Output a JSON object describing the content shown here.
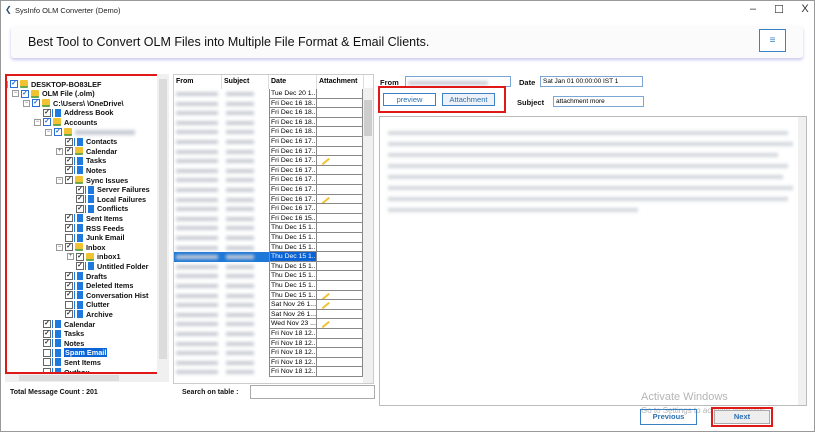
{
  "window": {
    "title": "SysInfo OLM Converter (Demo)",
    "minimize": "–",
    "maximize": "☐",
    "close": "X"
  },
  "banner": {
    "headline": "Best Tool to Convert OLM Files into Multiple File Format & Email Clients.",
    "menu_icon": "≡"
  },
  "tree": [
    {
      "label": "DESKTOP-BO83LEF",
      "depth": 0,
      "checked": true,
      "icon": "folder",
      "exp": "-"
    },
    {
      "label": "OLM File (.olm)",
      "depth": 1,
      "checked": true,
      "icon": "folder",
      "exp": "-"
    },
    {
      "label": "C:\\Users\\        \\OneDrive\\",
      "depth": 2,
      "checked": true,
      "icon": "folder",
      "exp": "-"
    },
    {
      "label": "Address Book",
      "depth": 3,
      "checked": true,
      "icon": "file"
    },
    {
      "label": "Accounts",
      "depth": 3,
      "checked": true,
      "icon": "folder",
      "exp": "-"
    },
    {
      "label": "",
      "depth": 4,
      "checked": true,
      "icon": "folder",
      "exp": "-",
      "blur": true
    },
    {
      "label": "Contacts",
      "depth": 5,
      "checked": true,
      "icon": "file"
    },
    {
      "label": "Calendar",
      "depth": 5,
      "checked": true,
      "icon": "folder",
      "exp": "+"
    },
    {
      "label": "Tasks",
      "depth": 5,
      "checked": true,
      "icon": "file"
    },
    {
      "label": "Notes",
      "depth": 5,
      "checked": true,
      "icon": "file"
    },
    {
      "label": "Sync Issues",
      "depth": 5,
      "checked": true,
      "icon": "folder",
      "exp": "-"
    },
    {
      "label": "Server Failures",
      "depth": 6,
      "checked": true,
      "icon": "file"
    },
    {
      "label": "Local Failures",
      "depth": 6,
      "checked": true,
      "icon": "file"
    },
    {
      "label": "Conflicts",
      "depth": 6,
      "checked": true,
      "icon": "file"
    },
    {
      "label": "Sent Items",
      "depth": 5,
      "checked": true,
      "icon": "file"
    },
    {
      "label": "RSS Feeds",
      "depth": 5,
      "checked": true,
      "icon": "file"
    },
    {
      "label": "Junk Email",
      "depth": 5,
      "checked": false,
      "icon": "file"
    },
    {
      "label": "Inbox",
      "depth": 5,
      "checked": true,
      "icon": "folder",
      "exp": "-"
    },
    {
      "label": "inbox1",
      "depth": 6,
      "checked": true,
      "icon": "folder",
      "exp": "+"
    },
    {
      "label": "Untitled Folder",
      "depth": 6,
      "checked": true,
      "icon": "file"
    },
    {
      "label": "Drafts",
      "depth": 5,
      "checked": true,
      "icon": "file"
    },
    {
      "label": "Deleted Items",
      "depth": 5,
      "checked": true,
      "icon": "file"
    },
    {
      "label": "Conversation Hist",
      "depth": 5,
      "checked": true,
      "icon": "file"
    },
    {
      "label": "Clutter",
      "depth": 5,
      "checked": false,
      "icon": "file"
    },
    {
      "label": "Archive",
      "depth": 5,
      "checked": true,
      "icon": "file"
    },
    {
      "label": "Calendar",
      "depth": 3,
      "checked": true,
      "icon": "file"
    },
    {
      "label": "Tasks",
      "depth": 3,
      "checked": true,
      "icon": "file"
    },
    {
      "label": "Notes",
      "depth": 3,
      "checked": true,
      "icon": "file"
    },
    {
      "label": "Spam Email",
      "depth": 3,
      "checked": false,
      "icon": "file",
      "selected": true
    },
    {
      "label": "Sent Items",
      "depth": 3,
      "checked": false,
      "icon": "file"
    },
    {
      "label": "Outbox",
      "depth": 3,
      "checked": false,
      "icon": "file"
    }
  ],
  "table": {
    "headers": [
      "From",
      "Subject",
      "Date",
      "Attachment"
    ],
    "rows": [
      {
        "date": "Tue Dec 20 1...",
        "att": false
      },
      {
        "date": "Fri Dec 16 18...",
        "att": false
      },
      {
        "date": "Fri Dec 16 18...",
        "att": false
      },
      {
        "date": "Fri Dec 16 18...",
        "att": false
      },
      {
        "date": "Fri Dec 16 18...",
        "att": false
      },
      {
        "date": "Fri Dec 16 17...",
        "att": false
      },
      {
        "date": "Fri Dec 16 17...",
        "att": false
      },
      {
        "date": "Fri Dec 16 17...",
        "att": true
      },
      {
        "date": "Fri Dec 16 17...",
        "att": false
      },
      {
        "date": "Fri Dec 16 17...",
        "att": false
      },
      {
        "date": "Fri Dec 16 17...",
        "att": false
      },
      {
        "date": "Fri Dec 16 17...",
        "att": true
      },
      {
        "date": "Fri Dec 16 17...",
        "att": false
      },
      {
        "date": "Fri Dec 16 15...",
        "att": false
      },
      {
        "date": "Thu Dec 15 1...",
        "att": false
      },
      {
        "date": "Thu Dec 15 1...",
        "att": false
      },
      {
        "date": "Thu Dec 15 1...",
        "att": false
      },
      {
        "date": "Thu Dec 15 1...",
        "att": false,
        "selected": true
      },
      {
        "date": "Thu Dec 15 1...",
        "att": false
      },
      {
        "date": "Thu Dec 15 1...",
        "att": false
      },
      {
        "date": "Thu Dec 15 1...",
        "att": false
      },
      {
        "date": "Thu Dec 15 1...",
        "att": true
      },
      {
        "date": "Sat Nov 26 1...",
        "att": true
      },
      {
        "date": "Sat Nov 26 1...",
        "att": false
      },
      {
        "date": "Wed Nov 23 ...",
        "att": true
      },
      {
        "date": "Fri Nov 18 12...",
        "att": false
      },
      {
        "date": "Fri Nov 18 12...",
        "att": false
      },
      {
        "date": "Fri Nov 18 12...",
        "att": false
      },
      {
        "date": "Fri Nov 18 12...",
        "att": false
      },
      {
        "date": "Fri Nov 18 12...",
        "att": false
      }
    ]
  },
  "detail": {
    "from_label": "From",
    "date_label": "Date",
    "date_value": "Sat Jan 01 00:00:00 IST 1",
    "subject_label": "Subject",
    "subject_value": "attachment more",
    "preview_button": "preview",
    "attachment_button": "Attachment"
  },
  "footer": {
    "total_count": "Total Message Count : 201",
    "search_label": "Search on table :",
    "search_value": "",
    "previous": "Previous",
    "next": "Next"
  },
  "watermark": {
    "line1": "Activate Windows",
    "line2": "Go to Settings to activate Windows."
  }
}
